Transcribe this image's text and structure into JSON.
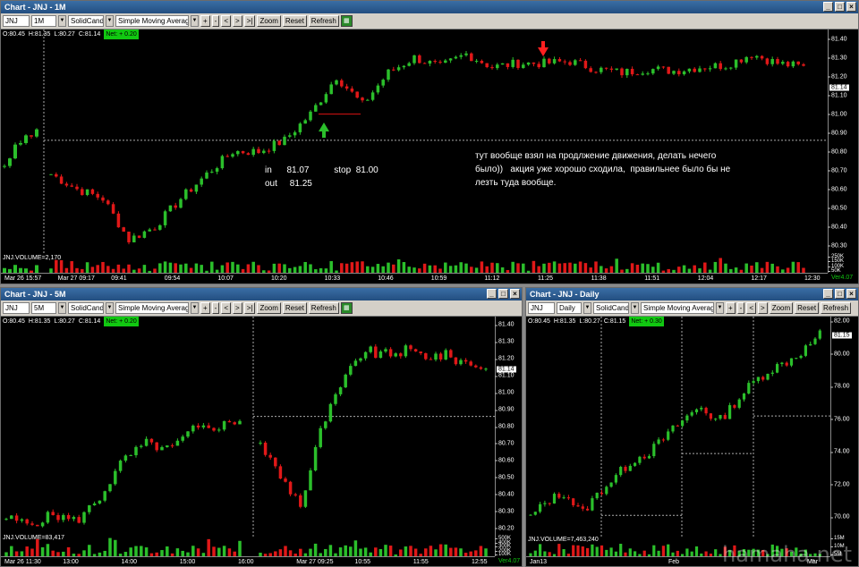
{
  "colors": {
    "up": "#2bbf2b",
    "down": "#e01818",
    "accent": "#11c811",
    "annotation_line": "#d01010"
  },
  "windows": [
    {
      "id": "w1",
      "title": "Chart - JNJ - 1M",
      "symbol": "JNJ",
      "interval": "1M",
      "style": "SolidCandle",
      "indicator": "Simple Moving Average",
      "buttons": {
        "first": ">|",
        "zoom": "Zoom",
        "reset": "Reset",
        "refresh": "Refresh"
      },
      "ohlc": {
        "o": "O:80.45",
        "h": "H:81.35",
        "l": "L:80.27",
        "c": "C:81.14",
        "net": "Net: + 0.20"
      },
      "y_ticks": [
        "81.40",
        "81.30",
        "81.20",
        "81.10",
        "81.00",
        "80.90",
        "80.80",
        "80.70",
        "80.60",
        "80.50",
        "80.40",
        "80.30"
      ],
      "last_price": "81.14",
      "x_ticks": [
        "Mar 26 15:57",
        "Mar 27 09:17",
        "09:41",
        "09:54",
        "10:07",
        "10:20",
        "10:33",
        "10:46",
        "10:59",
        "11:12",
        "11:25",
        "11:38",
        "11:51",
        "12:04",
        "12:17",
        "12:30"
      ],
      "volume_label": "JNJ.VOLUME=2,170",
      "volume_ticks": [
        "250K",
        "150K",
        "100K",
        "50K"
      ],
      "version": "Ver4.07",
      "annotations": {
        "trade": "in      81.07          stop  81.00\nout     81.25",
        "comment": "тут вообще взял на продлжение движения, делать нечего\nбыло))   акция уже хорошо сходила,  правильнее было бы не\nлезть туда вообще."
      },
      "chart_data": {
        "type": "candlestick",
        "ylim": [
          80.25,
          81.45
        ],
        "entry": 81.07,
        "stop": 81.0,
        "exit": 81.25
      }
    },
    {
      "id": "w2",
      "title": "Chart - JNJ - 5M",
      "symbol": "JNJ",
      "interval": "5M",
      "style": "SolidCandle",
      "indicator": "Simple Moving Average",
      "buttons": {
        "first": ">|",
        "zoom": "Zoom",
        "reset": "Reset",
        "refresh": "Refresh"
      },
      "ohlc": {
        "o": "O:80.45",
        "h": "H:81.35",
        "l": "L:80.27",
        "c": "C:81.14",
        "net": "Net: + 0.20"
      },
      "y_ticks": [
        "81.40",
        "81.30",
        "81.20",
        "81.10",
        "81.00",
        "80.90",
        "80.80",
        "80.70",
        "80.60",
        "80.50",
        "80.40",
        "80.30",
        "80.20"
      ],
      "last_price": "81.14",
      "x_ticks": [
        "Mar 26 11:30",
        "13:00",
        "14:00",
        "15:00",
        "16:00",
        "Mar 27 09:25",
        "10:55",
        "11:55",
        "12:55"
      ],
      "volume_label": "JNJ.VOLUME=83,417",
      "volume_ticks": [
        "500K",
        "400K",
        "300K",
        "200K",
        "100K"
      ],
      "version": "Ver4.07",
      "chart_data": {
        "type": "candlestick",
        "ylim": [
          80.15,
          81.45
        ]
      }
    },
    {
      "id": "w3",
      "title": "Chart - JNJ - Daily",
      "symbol": "JNJ",
      "interval": "Daily",
      "style": "SolidCandle",
      "indicator": "Simple Moving Average",
      "buttons": {
        "first": ">|",
        "zoom": "Zoom",
        "reset": "Reset",
        "refresh": "Refresh"
      },
      "ohlc": {
        "o": "O:80.45",
        "h": "H:81.35",
        "l": "L:80.27",
        "c": "C:81.15",
        "net": "Net: + 0.30"
      },
      "y_ticks": [
        "82.00",
        "80.00",
        "78.00",
        "76.00",
        "74.00",
        "72.00",
        "70.00"
      ],
      "last_price": "81.15",
      "x_ticks": [
        "Jan13",
        "Feb",
        "Mar"
      ],
      "volume_label": "JNJ.VOLUME=7,463,240",
      "volume_ticks": [
        "15M",
        "10M",
        "5M"
      ],
      "version": "",
      "chart_data": {
        "type": "candlestick",
        "ylim": [
          68.8,
          82.3
        ]
      }
    }
  ],
  "watermark": "hamaha.net"
}
